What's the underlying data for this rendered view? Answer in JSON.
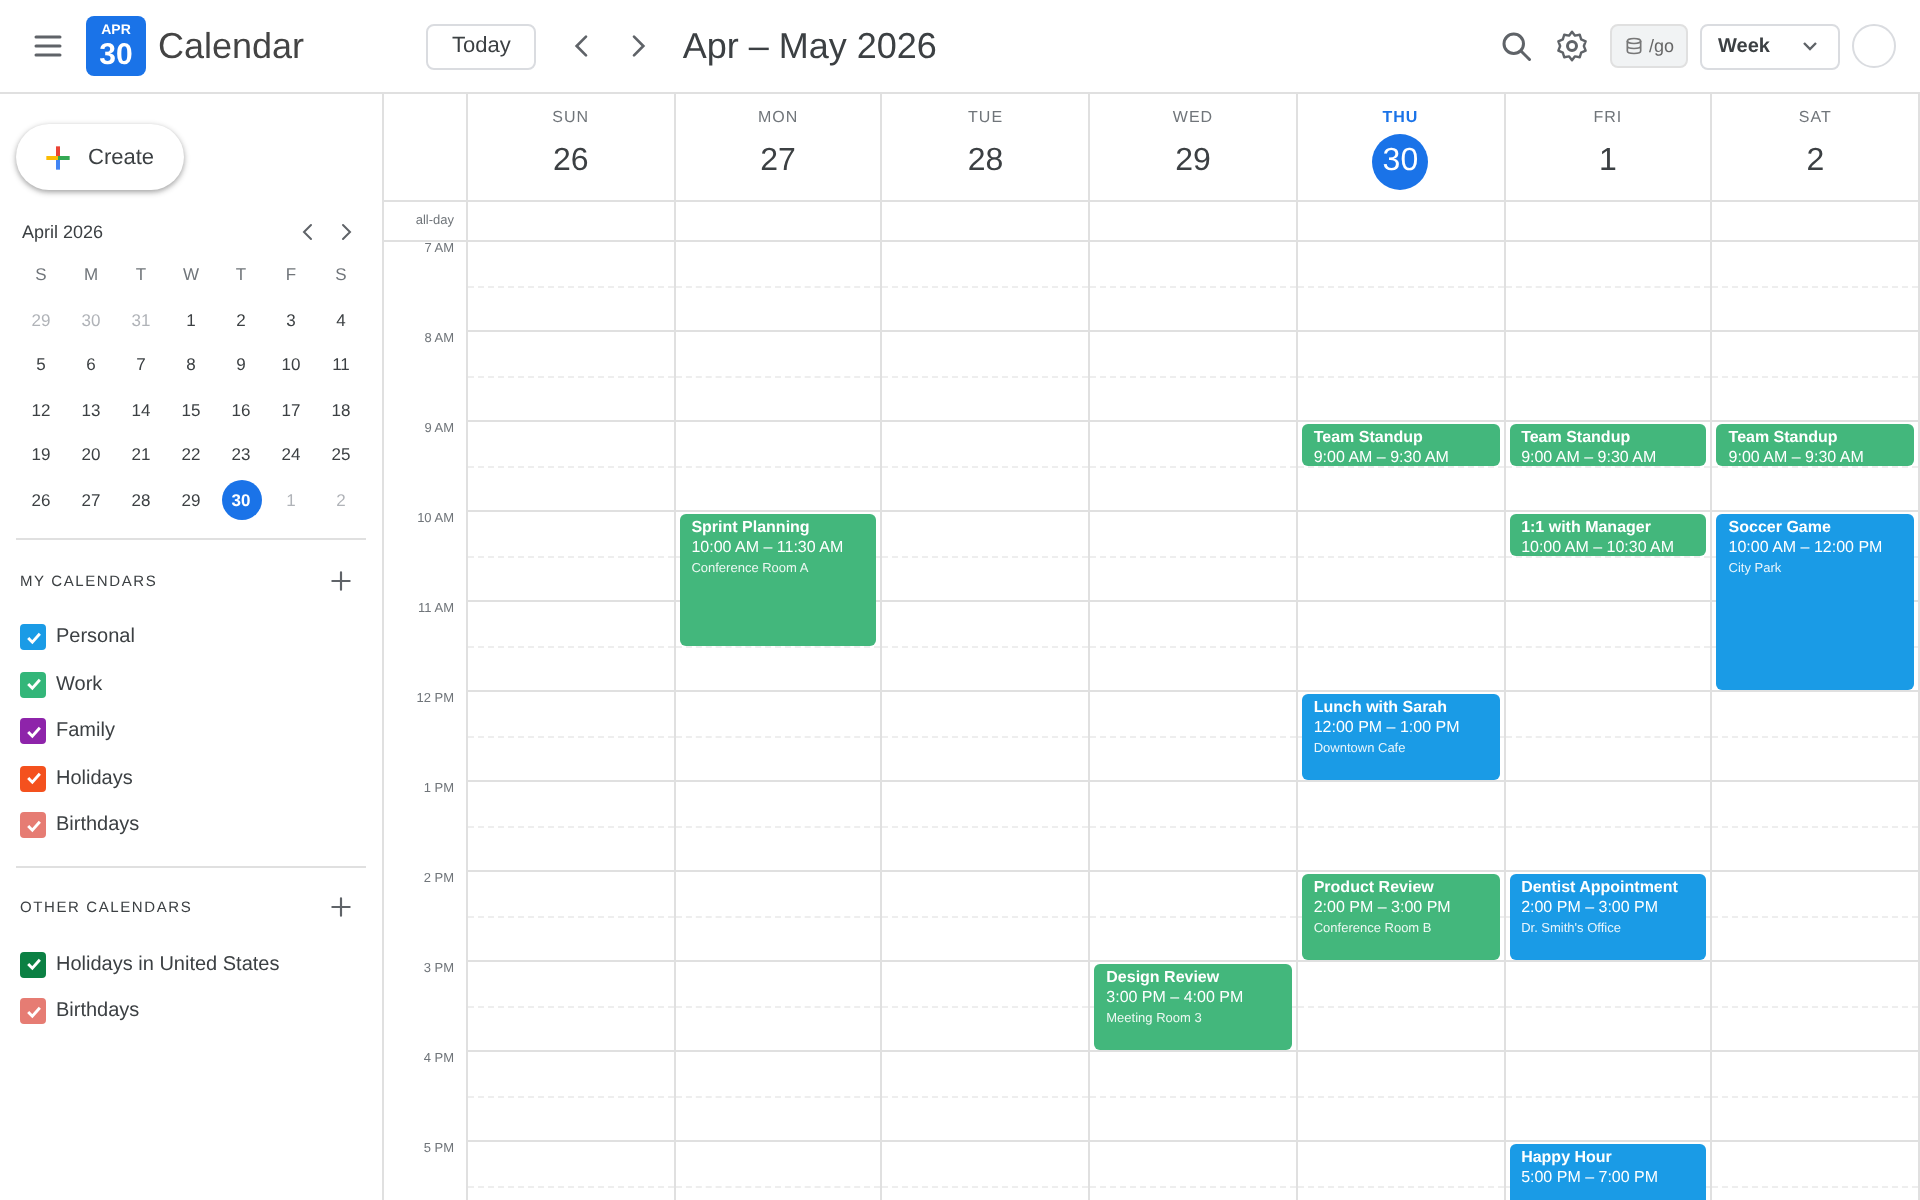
{
  "header": {
    "logo": {
      "month": "APR",
      "day": "30"
    },
    "app_name": "Calendar",
    "today_button": "Today",
    "range_title": "Apr – May 2026",
    "go_chip": "/go",
    "view_select": "Week"
  },
  "sidebar": {
    "create_button": "Create",
    "mini_calendar": {
      "title": "April 2026",
      "weekdays": [
        "S",
        "M",
        "T",
        "W",
        "T",
        "F",
        "S"
      ],
      "weeks": [
        [
          {
            "day": "29",
            "muted": true,
            "selected": false
          },
          {
            "day": "30",
            "muted": true,
            "selected": false
          },
          {
            "day": "31",
            "muted": true,
            "selected": false
          },
          {
            "day": "1",
            "muted": false,
            "selected": false
          },
          {
            "day": "2",
            "muted": false,
            "selected": false
          },
          {
            "day": "3",
            "muted": false,
            "selected": false
          },
          {
            "day": "4",
            "muted": false,
            "selected": false
          }
        ],
        [
          {
            "day": "5",
            "muted": false,
            "selected": false
          },
          {
            "day": "6",
            "muted": false,
            "selected": false
          },
          {
            "day": "7",
            "muted": false,
            "selected": false
          },
          {
            "day": "8",
            "muted": false,
            "selected": false
          },
          {
            "day": "9",
            "muted": false,
            "selected": false
          },
          {
            "day": "10",
            "muted": false,
            "selected": false
          },
          {
            "day": "11",
            "muted": false,
            "selected": false
          }
        ],
        [
          {
            "day": "12",
            "muted": false,
            "selected": false
          },
          {
            "day": "13",
            "muted": false,
            "selected": false
          },
          {
            "day": "14",
            "muted": false,
            "selected": false
          },
          {
            "day": "15",
            "muted": false,
            "selected": false
          },
          {
            "day": "16",
            "muted": false,
            "selected": false
          },
          {
            "day": "17",
            "muted": false,
            "selected": false
          },
          {
            "day": "18",
            "muted": false,
            "selected": false
          }
        ],
        [
          {
            "day": "19",
            "muted": false,
            "selected": false
          },
          {
            "day": "20",
            "muted": false,
            "selected": false
          },
          {
            "day": "21",
            "muted": false,
            "selected": false
          },
          {
            "day": "22",
            "muted": false,
            "selected": false
          },
          {
            "day": "23",
            "muted": false,
            "selected": false
          },
          {
            "day": "24",
            "muted": false,
            "selected": false
          },
          {
            "day": "25",
            "muted": false,
            "selected": false
          }
        ],
        [
          {
            "day": "26",
            "muted": false,
            "selected": false
          },
          {
            "day": "27",
            "muted": false,
            "selected": false
          },
          {
            "day": "28",
            "muted": false,
            "selected": false
          },
          {
            "day": "29",
            "muted": false,
            "selected": false
          },
          {
            "day": "30",
            "muted": false,
            "selected": true
          },
          {
            "day": "1",
            "muted": true,
            "selected": false
          },
          {
            "day": "2",
            "muted": true,
            "selected": false
          }
        ]
      ]
    },
    "calendar_groups": [
      {
        "title": "MY CALENDARS",
        "items": [
          {
            "label": "Personal",
            "color": "#1a9be6",
            "checked": true
          },
          {
            "label": "Work",
            "color": "#33b679",
            "checked": true
          },
          {
            "label": "Family",
            "color": "#8e24aa",
            "checked": true
          },
          {
            "label": "Holidays",
            "color": "#f4511e",
            "checked": true
          },
          {
            "label": "Birthdays",
            "color": "#e67c73",
            "checked": true
          }
        ]
      },
      {
        "title": "OTHER CALENDARS",
        "items": [
          {
            "label": "Holidays in United States",
            "color": "#0b8043",
            "checked": true
          },
          {
            "label": "Birthdays",
            "color": "#e67c73",
            "checked": true
          }
        ]
      }
    ]
  },
  "week": {
    "all_day_label": "all-day",
    "hour_labels": [
      "7 AM",
      "8 AM",
      "9 AM",
      "10 AM",
      "11 AM",
      "12 PM",
      "1 PM",
      "2 PM",
      "3 PM",
      "4 PM",
      "5 PM"
    ],
    "days": [
      {
        "name": "SUN",
        "date": "26",
        "today": false
      },
      {
        "name": "MON",
        "date": "27",
        "today": false,
        "events": [
          {
            "title": "Sprint Planning",
            "time": "10:00 AM – 11:30 AM",
            "location": "Conference Room A",
            "color": "#43b77c"
          }
        ]
      },
      {
        "name": "TUE",
        "date": "28",
        "today": false
      },
      {
        "name": "WED",
        "date": "29",
        "today": false,
        "events": [
          {
            "title": "Design Review",
            "time": "3:00 PM – 4:00 PM",
            "location": "Meeting Room 3",
            "color": "#43b77c"
          }
        ]
      },
      {
        "name": "THU",
        "date": "30",
        "today": true,
        "events": [
          {
            "title": "Team Standup",
            "time": "9:00 AM – 9:30 AM",
            "color": "#43b77c"
          },
          {
            "title": "Lunch with Sarah",
            "time": "12:00 PM – 1:00 PM",
            "location": "Downtown Cafe",
            "color": "#1a9be6"
          },
          {
            "title": "Product Review",
            "time": "2:00 PM – 3:00 PM",
            "location": "Conference Room B",
            "color": "#43b77c"
          }
        ]
      },
      {
        "name": "FRI",
        "date": "1",
        "today": false,
        "events": [
          {
            "title": "Team Standup",
            "time": "9:00 AM – 9:30 AM",
            "color": "#43b77c"
          },
          {
            "title": "1:1 with Manager",
            "time": "10:00 AM – 10:30 AM",
            "color": "#43b77c"
          },
          {
            "title": "Dentist Appointment",
            "time": "2:00 PM – 3:00 PM",
            "location": "Dr. Smith's Office",
            "color": "#1a9be6"
          },
          {
            "title": "Happy Hour",
            "time": "5:00 PM – 7:00 PM",
            "color": "#1a9be6"
          }
        ]
      },
      {
        "name": "SAT",
        "date": "2",
        "today": false,
        "events": [
          {
            "title": "Team Standup",
            "time": "9:00 AM – 9:30 AM",
            "color": "#43b77c"
          },
          {
            "title": "Soccer Game",
            "time": "10:00 AM – 12:00 PM",
            "location": "City Park",
            "color": "#1a9be6"
          }
        ]
      }
    ]
  }
}
